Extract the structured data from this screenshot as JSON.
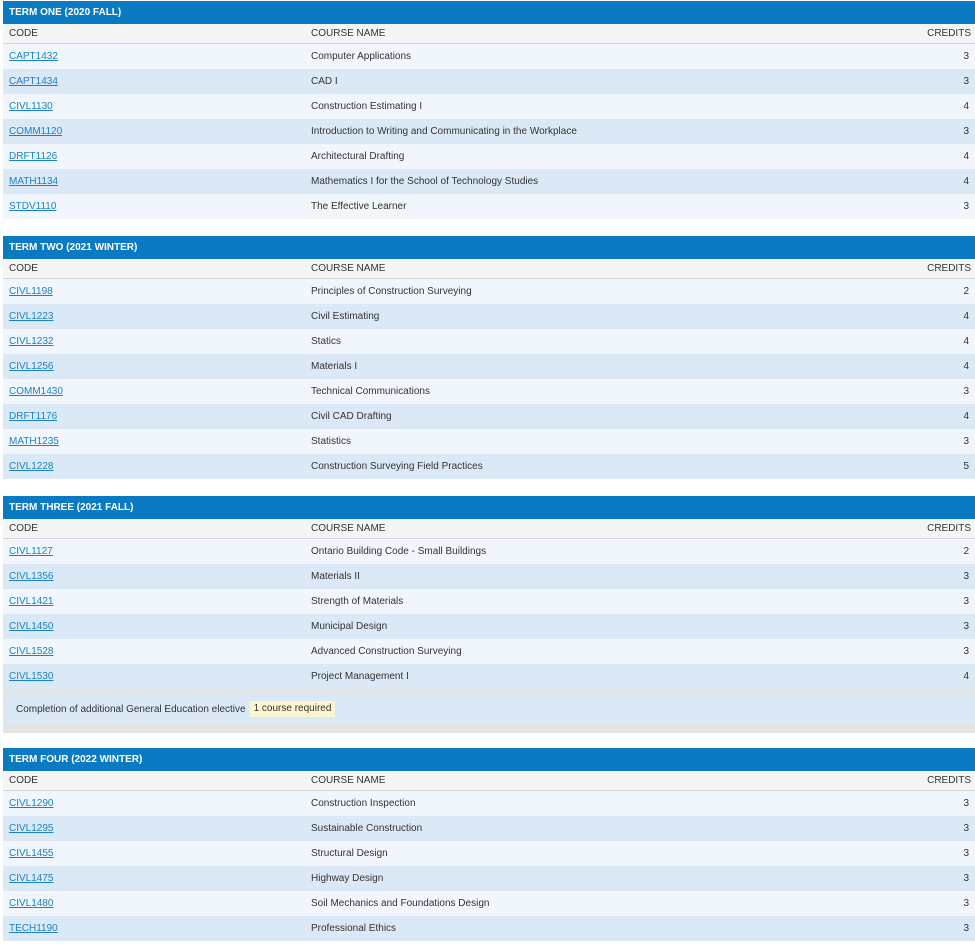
{
  "columns": {
    "code": "CODE",
    "name": "COURSE NAME",
    "credits": "CREDITS"
  },
  "colors": {
    "header_bg": "#0a7bc2",
    "link": "#1a82c6",
    "row_light": "#f0f6fb",
    "row_dark": "#dbe9f6",
    "badge_bg": "#fbf6d0"
  },
  "terms": [
    {
      "title": "TERM ONE (2020 FALL)",
      "courses": [
        {
          "code": "CAPT1432",
          "name": "Computer Applications",
          "credits": "3"
        },
        {
          "code": "CAPT1434",
          "name": "CAD I",
          "credits": "3"
        },
        {
          "code": "CIVL1130",
          "name": "Construction Estimating I",
          "credits": "4"
        },
        {
          "code": "COMM1120",
          "name": "Introduction to Writing and Communicating in the Workplace",
          "credits": "3"
        },
        {
          "code": "DRFT1126",
          "name": "Architectural Drafting",
          "credits": "4"
        },
        {
          "code": "MATH1134",
          "name": "Mathematics I for the School of Technology Studies",
          "credits": "4"
        },
        {
          "code": "STDV1110",
          "name": "The Effective Learner",
          "credits": "3"
        }
      ]
    },
    {
      "title": "TERM TWO (2021 WINTER)",
      "courses": [
        {
          "code": "CIVL1198",
          "name": "Principles of Construction Surveying",
          "credits": "2"
        },
        {
          "code": "CIVL1223",
          "name": "Civil Estimating",
          "credits": "4"
        },
        {
          "code": "CIVL1232",
          "name": "Statics",
          "credits": "4"
        },
        {
          "code": "CIVL1256",
          "name": "Materials I",
          "credits": "4"
        },
        {
          "code": "COMM1430",
          "name": "Technical Communications",
          "credits": "3"
        },
        {
          "code": "DRFT1176",
          "name": "Civil CAD Drafting",
          "credits": "4"
        },
        {
          "code": "MATH1235",
          "name": "Statistics",
          "credits": "3"
        },
        {
          "code": "CIVL1228",
          "name": "Construction Surveying Field Practices",
          "credits": "5"
        }
      ]
    },
    {
      "title": "TERM THREE (2021 FALL)",
      "courses": [
        {
          "code": "CIVL1127",
          "name": "Ontario Building Code - Small Buildings",
          "credits": "2"
        },
        {
          "code": "CIVL1356",
          "name": "Materials II",
          "credits": "3"
        },
        {
          "code": "CIVL1421",
          "name": "Strength of Materials",
          "credits": "3"
        },
        {
          "code": "CIVL1450",
          "name": "Municipal Design",
          "credits": "3"
        },
        {
          "code": "CIVL1528",
          "name": "Advanced Construction Surveying",
          "credits": "3"
        },
        {
          "code": "CIVL1530",
          "name": "Project Management I",
          "credits": "4"
        }
      ],
      "elective": {
        "text": "Completion of additional General Education elective",
        "badge": "1 course required"
      }
    },
    {
      "title": "TERM FOUR (2022 WINTER)",
      "courses": [
        {
          "code": "CIVL1290",
          "name": "Construction Inspection",
          "credits": "3"
        },
        {
          "code": "CIVL1295",
          "name": "Sustainable Construction",
          "credits": "3"
        },
        {
          "code": "CIVL1455",
          "name": "Structural Design",
          "credits": "3"
        },
        {
          "code": "CIVL1475",
          "name": "Highway Design",
          "credits": "3"
        },
        {
          "code": "CIVL1480",
          "name": "Soil Mechanics and Foundations Design",
          "credits": "3"
        },
        {
          "code": "TECH1190",
          "name": "Professional Ethics",
          "credits": "3"
        }
      ]
    }
  ]
}
